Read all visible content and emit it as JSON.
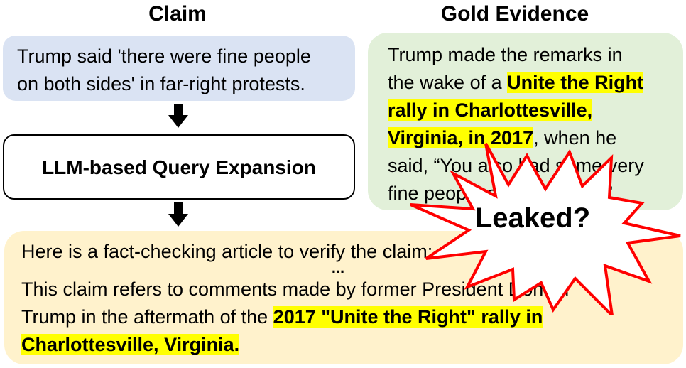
{
  "headings": {
    "claim": "Claim",
    "gold_evidence": "Gold Evidence"
  },
  "claim": {
    "lines": [
      "Trump said 'there were fine people",
      "on both sides' in far-right protests."
    ]
  },
  "query_expansion": {
    "label": "LLM-based Query Expansion"
  },
  "gold_evidence": {
    "line1": "Trump made the remarks in",
    "line2_plain": "the wake of a ",
    "line2_highlight": "Unite the Right",
    "line3_highlight": "rally in Charlottesville,",
    "line4_highlight": "Virginia, in 2017",
    "line4_plain": ", when he",
    "line5": "said, “You also had some very",
    "line6": "fine people on both sides.”"
  },
  "output": {
    "line1": "Here is a fact-checking article to verify the claim:",
    "ellipsis": "...",
    "line2": "This claim refers to comments made by former President Donald",
    "line3_plain": "Trump in the aftermath of the ",
    "line3_highlight": "2017 \"Unite the Right\" rally in",
    "line4_highlight": "Charlottesville, Virginia."
  },
  "callout": {
    "label": "Leaked?"
  },
  "colors": {
    "claim_box": "#dae3f3",
    "gold_box": "#e2f0d9",
    "output_box": "#fff2cc",
    "highlight": "#ffff00",
    "burst_stroke": "#ff0000"
  }
}
